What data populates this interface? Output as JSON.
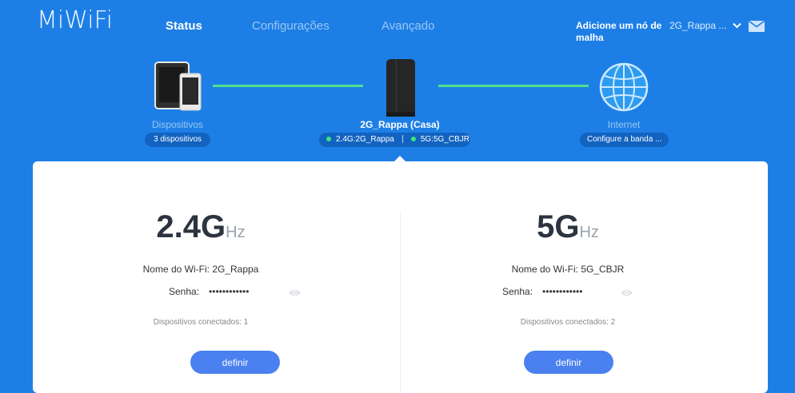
{
  "header": {
    "logo": "MiWiFi",
    "nav": [
      "Status",
      "Configurações",
      "Avançado"
    ],
    "mesh_link": "Adicione um nó de malha",
    "router_selector": "2G_Rappa ..."
  },
  "topology": {
    "devices": {
      "label": "Dispositivos",
      "pill": "3 dispositivos"
    },
    "router": {
      "name": "2G_Rappa (Casa)",
      "band24": "2.4G:2G_Rappa",
      "band5": "5G:5G_CBJR"
    },
    "internet": {
      "label": "Internet",
      "pill": "Configure a banda ..."
    }
  },
  "bands": [
    {
      "title": "2.4G",
      "unit": "Hz",
      "wifi_label": "Nome do Wi-Fi:",
      "wifi_name": "2G_Rappa",
      "password_label": "Senha:",
      "password": "••••••••••••",
      "connected_label": "Dispositivos conectados:",
      "connected": "1",
      "button": "definir"
    },
    {
      "title": "5G",
      "unit": "Hz",
      "wifi_label": "Nome do Wi-Fi:",
      "wifi_name": "5G_CBJR",
      "password_label": "Senha:",
      "password": "••••••••••••",
      "connected_label": "Dispositivos conectados:",
      "connected": "2",
      "button": "definir"
    }
  ],
  "colors": {
    "background": "#1d7fe6",
    "link_line": "#4fe08a",
    "button": "#4a80f0"
  }
}
